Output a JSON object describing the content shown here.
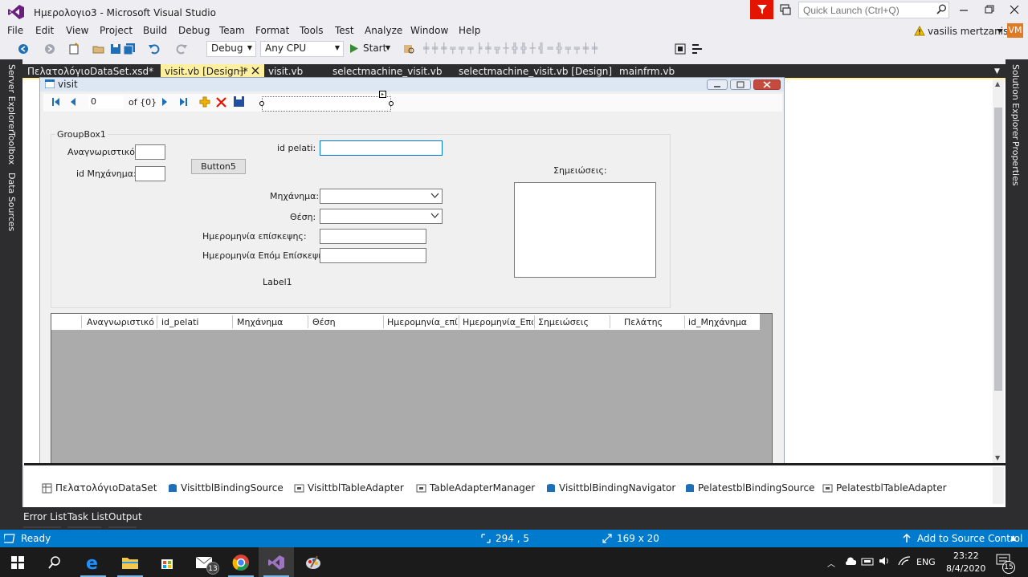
{
  "window": {
    "title": "Ημερολογιο3 - Microsoft Visual Studio",
    "quick_launch_placeholder": "Quick Launch (Ctrl+Q)",
    "user_name": "vasilis mertzanis",
    "user_initials": "VM"
  },
  "menu": [
    "File",
    "Edit",
    "View",
    "Project",
    "Build",
    "Debug",
    "Team",
    "Format",
    "Tools",
    "Test",
    "Analyze",
    "Window",
    "Help"
  ],
  "toolbar": {
    "configuration": "Debug",
    "platform": "Any CPU",
    "start_label": "Start"
  },
  "side_panels": {
    "left": [
      "Server Explorer",
      "Toolbox",
      "Data Sources"
    ],
    "right": [
      "Solution Explorer",
      "Properties"
    ]
  },
  "tabs": [
    {
      "label": "ΠελατολόγιοDataSet.xsd*"
    },
    {
      "label": "visit.vb [Design]*",
      "active": true
    },
    {
      "label": "visit.vb"
    },
    {
      "label": "selectmachine_visit.vb"
    },
    {
      "label": "selectmachine_visit.vb [Design]"
    },
    {
      "label": "mainfrm.vb"
    }
  ],
  "form": {
    "caption": "visit",
    "navigator": {
      "position": "0",
      "count_text": "of {0}"
    },
    "groupbox_title": "GroupBox1",
    "labels": {
      "id_label": "Αναγνωριστικό:",
      "machine_id_label": "id Μηχάνημα:",
      "button": "Button5",
      "client_id": "id pelati:",
      "machine": "Μηχάνημα:",
      "position": "Θέση:",
      "visit_date": "Ημερομηνία επίσκεψης:",
      "next_visit_date": "Ημερομηνία Επόμ Επίσκεψης:",
      "label1": "Label1",
      "notes": "Σημειώσεις:"
    },
    "grid_columns": [
      "Αναγνωριστικό",
      "id_pelati",
      "Μηχάνημα",
      "Θέση",
      "Ημερομηνία_επίσκ",
      "Ημερομηνία_Επόμ_",
      "Σημειώσεις",
      "Πελάτης",
      "id_Μηχάνημα"
    ]
  },
  "component_tray": [
    "ΠελατολόγιοDataSet",
    "VisittblBindingSource",
    "VisittblTableAdapter",
    "TableAdapterManager",
    "VisittblBindingNavigator",
    "PelatestblBindingSource",
    "PelatestblTableAdapter"
  ],
  "bottom_tabs": [
    "Error List",
    "Task List",
    "Output"
  ],
  "status": {
    "ready": "Ready",
    "position": "294 , 5",
    "size": "169 x 20",
    "source_control": "Add to Source Control"
  },
  "taskbar": {
    "mail_badge": "13",
    "language": "ENG",
    "time": "23:22",
    "date": "8/4/2020",
    "notifications": "15"
  },
  "colors": {
    "accent": "#007acc",
    "active_tab": "#fff0a0",
    "vs_purple": "#68217a",
    "feedback_red": "#e51400"
  }
}
